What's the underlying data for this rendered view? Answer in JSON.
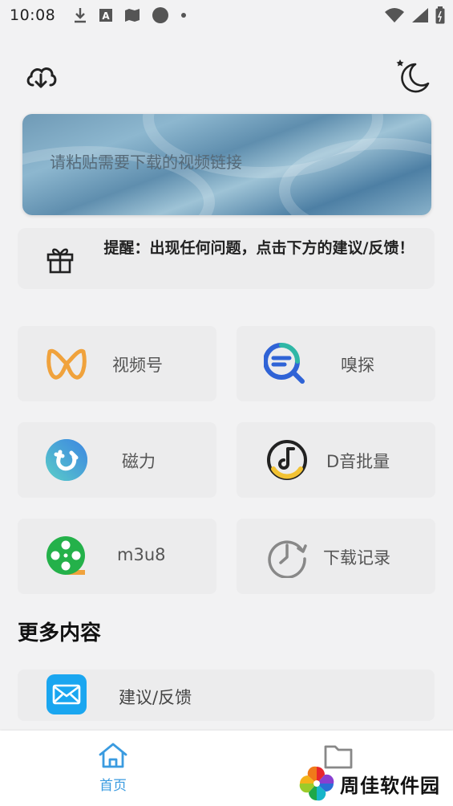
{
  "status_bar": {
    "time": "10:08",
    "icons_left": [
      "download-icon",
      "font-icon",
      "map-icon",
      "circle-icon",
      "dot-icon"
    ],
    "icons_right": [
      "wifi-icon",
      "signal-icon",
      "battery-icon"
    ]
  },
  "header": {
    "cloud_icon": "cloud-download-icon",
    "theme_icon": "moon-icon"
  },
  "url_input": {
    "placeholder": "请粘贴需要下载的视频链接",
    "value": ""
  },
  "notice": {
    "icon": "gift-icon",
    "text": "提醒：出现任何问题，点击下方的建议/反馈！"
  },
  "features": [
    {
      "label": "视频号",
      "icon": "wechat-channels-icon"
    },
    {
      "label": "嗅探",
      "icon": "sniff-search-icon"
    },
    {
      "label": "磁力",
      "icon": "magnet-icon"
    },
    {
      "label": "D音批量",
      "icon": "douyin-music-icon"
    },
    {
      "label": "m3u8",
      "icon": "film-reel-icon"
    },
    {
      "label": "下载记录",
      "icon": "history-clock-icon"
    }
  ],
  "more": {
    "title": "更多内容",
    "items": [
      {
        "label": "建议/反馈",
        "icon": "mail-icon"
      }
    ]
  },
  "bottom_nav": {
    "home_label": "首页",
    "home_icon": "home-icon",
    "files_icon": "folder-icon"
  },
  "watermark": {
    "text": "周佳软件园",
    "icon": "pinwheel-logo"
  },
  "colors": {
    "accent": "#3a9be0",
    "background": "#f2f2f3",
    "card": "#ececed",
    "wechat_orange": "#f0a23c",
    "sniff_blue": "#2f63d6",
    "sniff_teal": "#2fb7a6",
    "magnet_blue": "#47a9e6",
    "film_green": "#24b14a",
    "mail_blue": "#1aa6f0"
  }
}
